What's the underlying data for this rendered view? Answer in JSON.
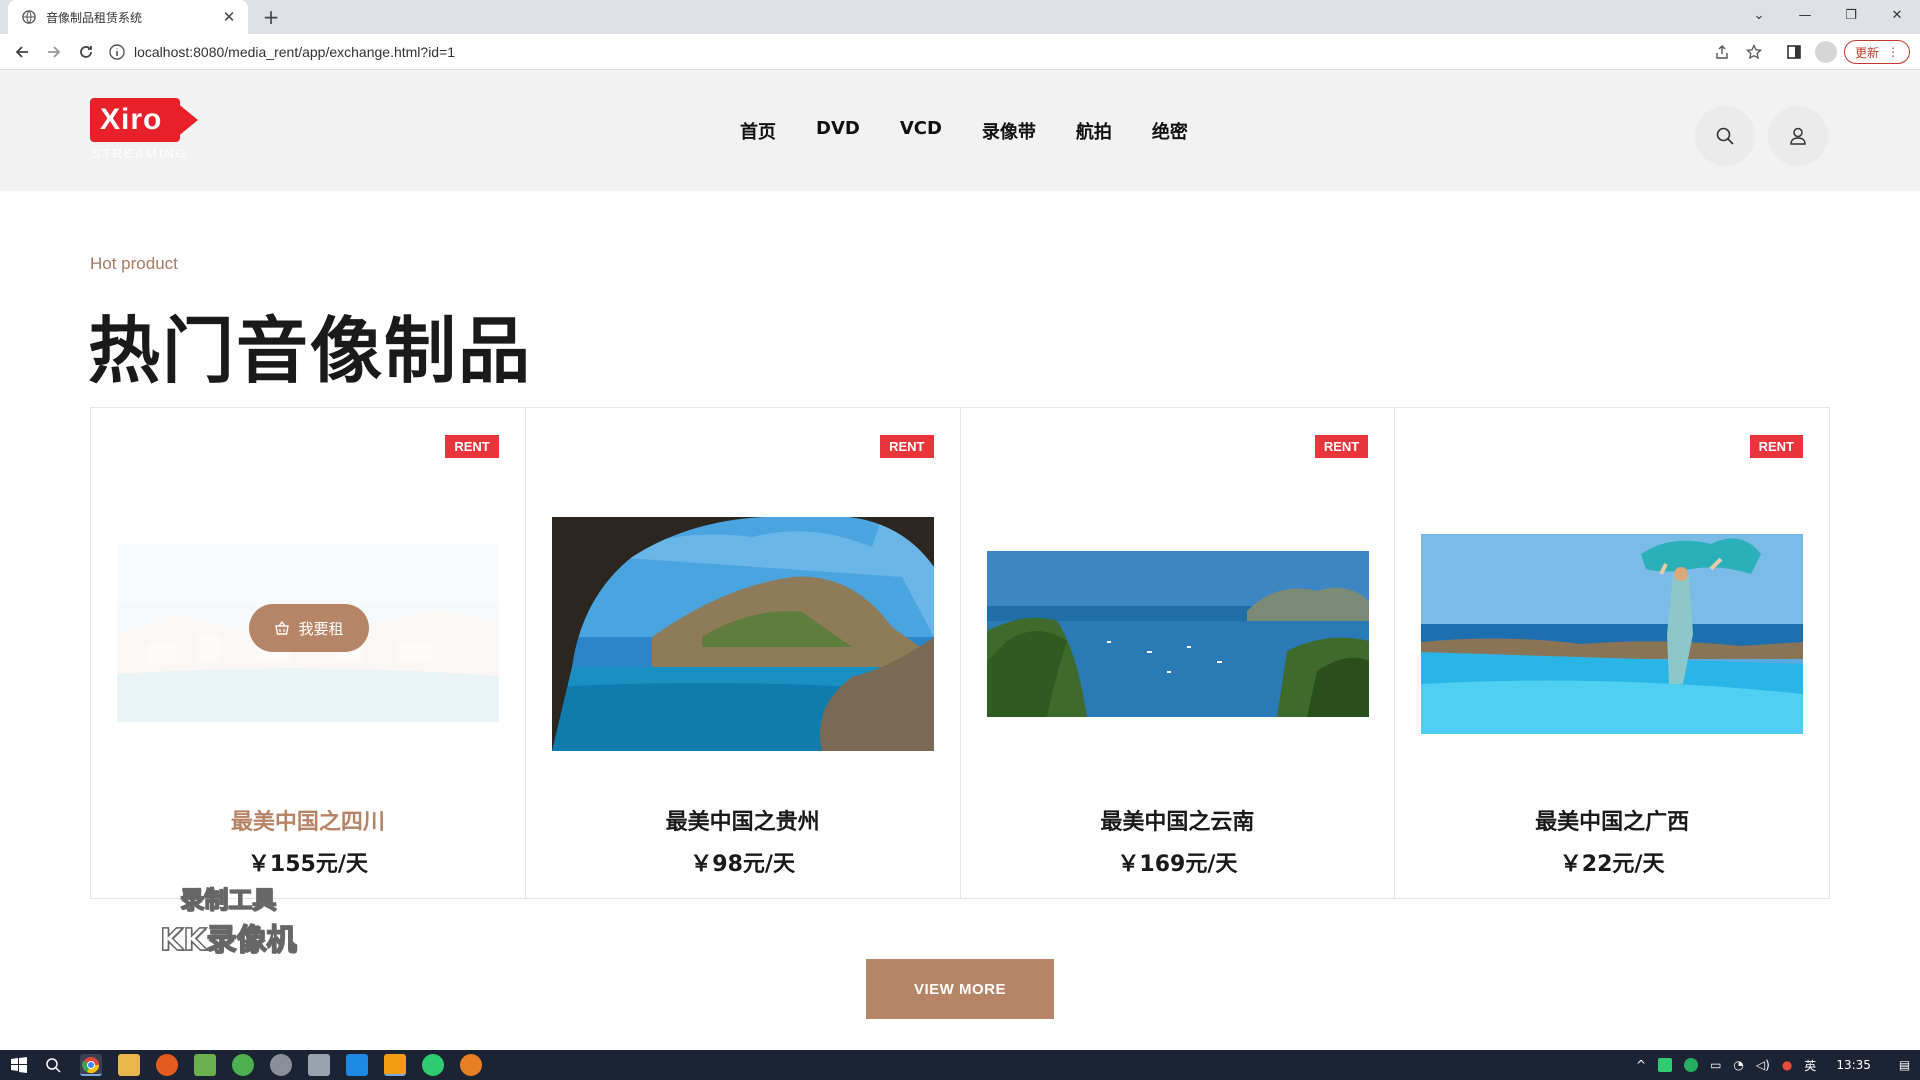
{
  "browser": {
    "tab_title": "音像制品租赁系统",
    "url": "localhost:8080/media_rent/app/exchange.html?id=1",
    "update_label": "更新"
  },
  "site": {
    "logo_text": "Xiro",
    "logo_sub": "STREAMING",
    "nav": [
      "首页",
      "DVD",
      "VCD",
      "录像带",
      "航拍",
      "绝密"
    ]
  },
  "section": {
    "kicker": "Hot product",
    "title": "热门音像制品"
  },
  "products": [
    {
      "title": "最美中国之四川",
      "price": "￥155元/天",
      "badge": "RENT",
      "scene": "coastal-town",
      "hovered": true,
      "action_label": "我要租"
    },
    {
      "title": "最美中国之贵州",
      "price": "￥98元/天",
      "badge": "RENT",
      "scene": "sea-cave-arch"
    },
    {
      "title": "最美中国之云南",
      "price": "￥169元/天",
      "badge": "RENT",
      "scene": "bay-with-boats"
    },
    {
      "title": "最美中国之广西",
      "price": "￥22元/天",
      "badge": "RENT",
      "scene": "infinity-pool"
    }
  ],
  "view_more_label": "VIEW MORE",
  "watermark": {
    "line1": "录制工具",
    "line2": "KK录像机"
  },
  "taskbar": {
    "ime": "英",
    "time": "13:35"
  },
  "colors": {
    "accent": "#b68466",
    "badge": "#e8343a",
    "logo_red": "#e8202a"
  }
}
